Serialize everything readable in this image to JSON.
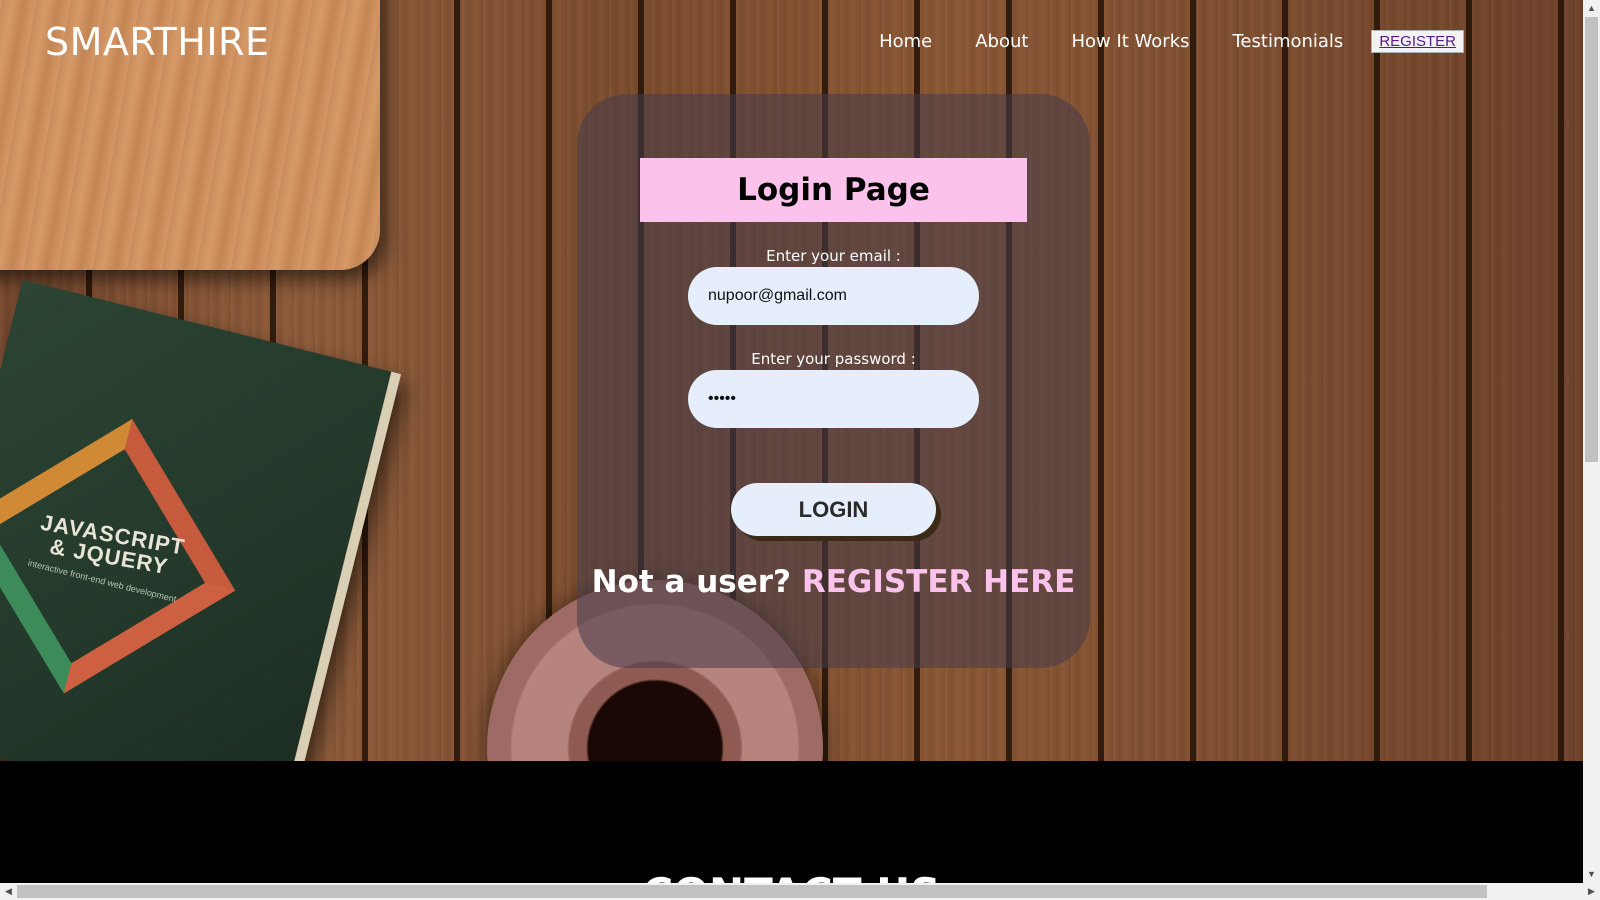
{
  "header": {
    "logo": "SMARTHIRE",
    "nav": [
      {
        "label": "Home"
      },
      {
        "label": "About"
      },
      {
        "label": "How It Works"
      },
      {
        "label": "Testimonials"
      }
    ],
    "register_label": "REGISTER"
  },
  "login": {
    "title": "Login Page",
    "email_label": "Enter your email :",
    "email_value": "nupoor@gmail.com",
    "password_label": "Enter your password :",
    "password_value": "•••••",
    "login_button": "LOGIN",
    "not_user_text": "Not a user?",
    "register_link": "REGISTER HERE"
  },
  "background": {
    "book_title_line1": "JAVASCRIPT",
    "book_title_line2": "& JQUERY",
    "book_subtitle": "interactive front-end web development"
  },
  "footer": {
    "title": "CONTACT US"
  },
  "colors": {
    "accent_pink": "#fbc3ec",
    "input_bg": "#e6eefb",
    "card_bg": "rgba(70,60,75,0.55)"
  }
}
